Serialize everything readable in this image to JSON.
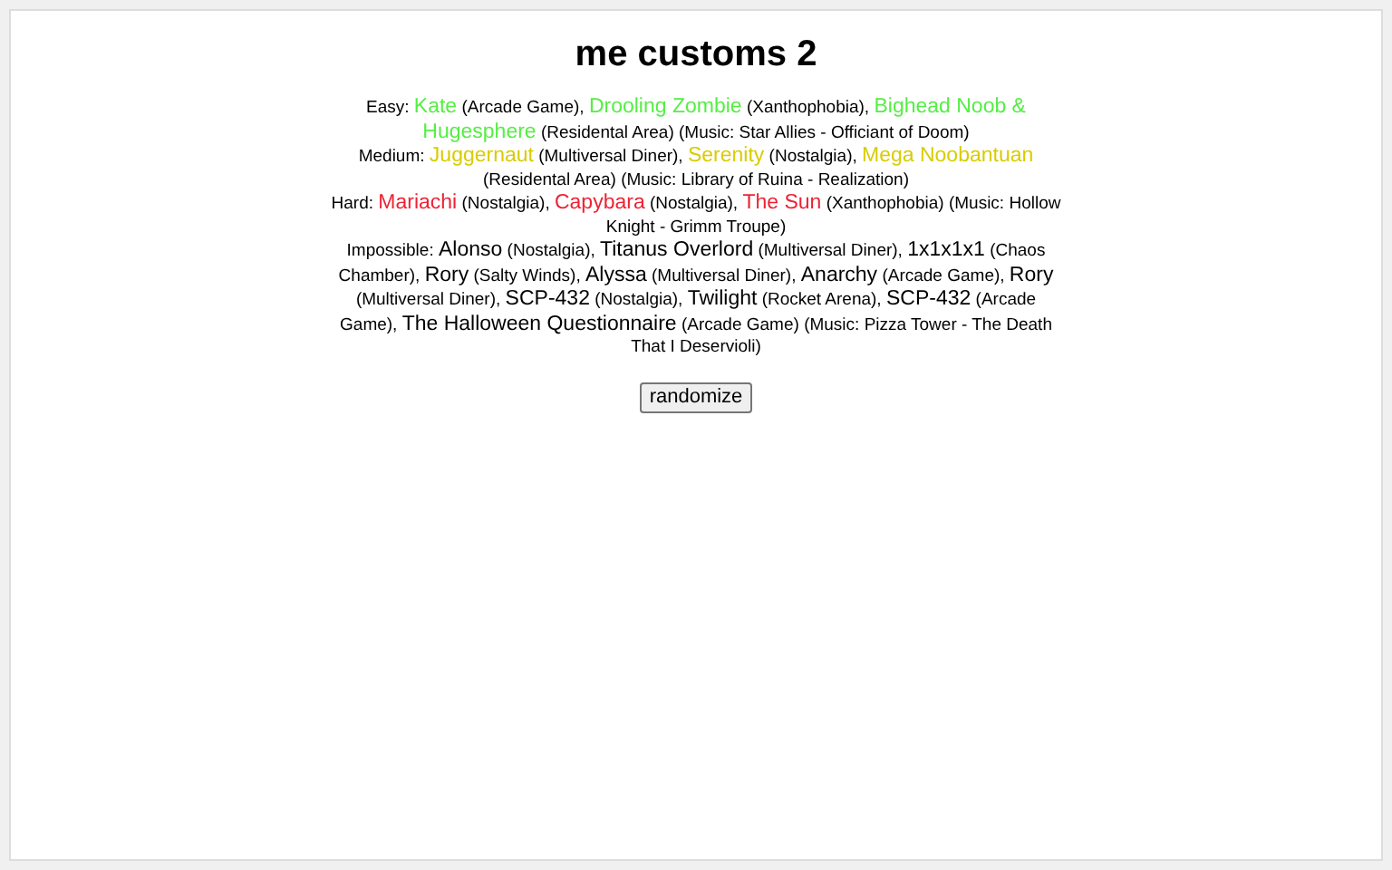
{
  "title": "me customs 2",
  "tiers": [
    {
      "label": "Easy:",
      "characters": [
        {
          "name": "Kate",
          "place": "(Arcade Game),",
          "color": "#55ee44"
        },
        {
          "name": "Drooling Zombie",
          "place": "(Xanthophobia),",
          "color": "#55ee44"
        },
        {
          "name": "Bighead Noob & Hugesphere",
          "place": "(Residental Area)",
          "color": "#55ee44"
        }
      ],
      "music": "(Music: Star Allies - Officiant of Doom)"
    },
    {
      "label": "Medium:",
      "characters": [
        {
          "name": "Juggernaut",
          "place": "(Multiversal Diner),",
          "color": "#d8cc00"
        },
        {
          "name": "Serenity",
          "place": "(Nostalgia),",
          "color": "#d8cc00"
        },
        {
          "name": "Mega Noobantuan",
          "place": "(Residental Area)",
          "color": "#d8cc00"
        }
      ],
      "music": "(Music: Library of Ruina - Realization)"
    },
    {
      "label": "Hard:",
      "characters": [
        {
          "name": "Mariachi",
          "place": "(Nostalgia),",
          "color": "#ee2233"
        },
        {
          "name": "Capybara",
          "place": "(Nostalgia),",
          "color": "#ee2233"
        },
        {
          "name": "The Sun",
          "place": "(Xanthophobia)",
          "color": "#ee2233"
        }
      ],
      "music": "(Music: Hollow Knight - Grimm Troupe)"
    },
    {
      "label": "Impossible:",
      "characters": [
        {
          "name": "Alonso",
          "place": "(Nostalgia),",
          "color": "#000000"
        },
        {
          "name": "Titanus Overlord",
          "place": "(Multiversal Diner),",
          "color": "#000000"
        },
        {
          "name": "1x1x1x1",
          "place": "(Chaos Chamber),",
          "color": "#000000"
        },
        {
          "name": "Rory",
          "place": "(Salty Winds),",
          "color": "#000000"
        },
        {
          "name": "Alyssa",
          "place": "(Multiversal Diner),",
          "color": "#000000"
        },
        {
          "name": "Anarchy",
          "place": "(Arcade Game),",
          "color": "#000000"
        },
        {
          "name": "Rory",
          "place": "(Multiversal Diner),",
          "color": "#000000"
        },
        {
          "name": "SCP-432",
          "place": "(Nostalgia),",
          "color": "#000000"
        },
        {
          "name": "Twilight",
          "place": "(Rocket Arena),",
          "color": "#000000"
        },
        {
          "name": "SCP-432",
          "place": "(Arcade Game),",
          "color": "#000000"
        },
        {
          "name": "The Halloween Questionnaire",
          "place": "(Arcade Game)",
          "color": "#000000"
        }
      ],
      "music": "(Music: Pizza Tower - The Death That I Deservioli)"
    }
  ],
  "button": "randomize"
}
